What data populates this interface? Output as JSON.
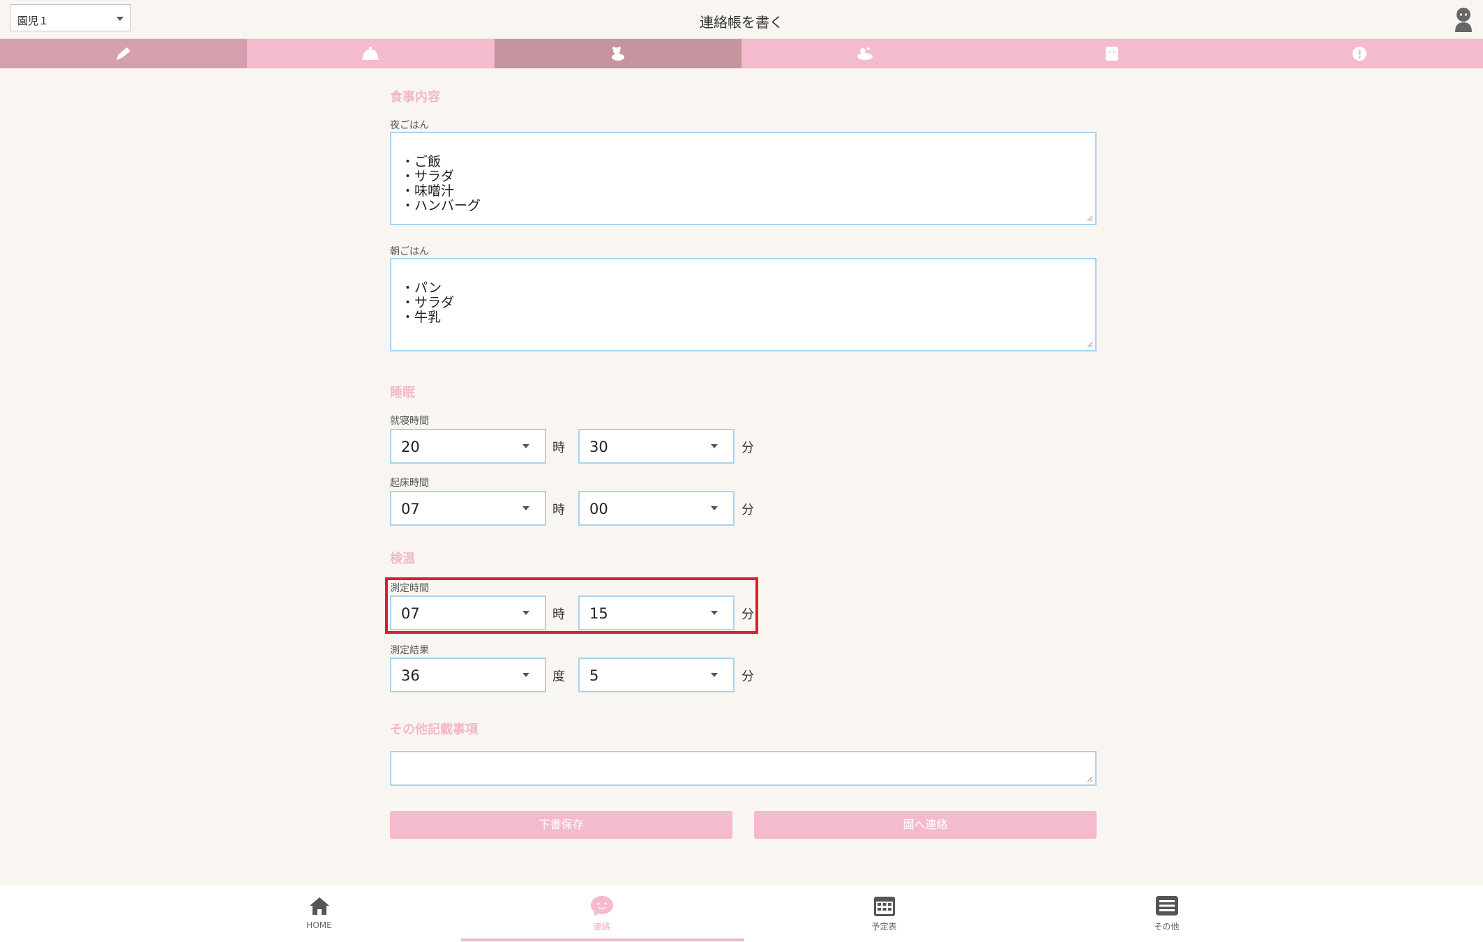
{
  "header": {
    "child_select": "園児１",
    "title": "連絡帳を書く"
  },
  "tabs": [
    {
      "icon": "pencil-icon"
    },
    {
      "icon": "meal-icon"
    },
    {
      "icon": "sleep-bear-icon"
    },
    {
      "icon": "bath-icon"
    },
    {
      "icon": "notebook-icon"
    },
    {
      "icon": "alert-icon"
    }
  ],
  "meal": {
    "section_title": "食事内容",
    "dinner_label": "夜ごはん",
    "dinner_value": "・ご飯\n・サラダ\n・味噌汁\n・ハンバーグ",
    "breakfast_label": "朝ごはん",
    "breakfast_value": "・パン\n・サラダ\n・牛乳"
  },
  "sleep": {
    "section_title": "睡眠",
    "bedtime_label": "就寝時間",
    "bedtime_hour": "20",
    "bedtime_minute": "30",
    "wake_label": "起床時間",
    "wake_hour": "07",
    "wake_minute": "00"
  },
  "temperature": {
    "section_title": "検温",
    "measure_time_label": "測定時間",
    "measure_hour": "07",
    "measure_minute": "15",
    "result_label": "測定結果",
    "result_degree": "36",
    "result_decimal": "5"
  },
  "units": {
    "hour": "時",
    "minute": "分",
    "degree": "度"
  },
  "notes": {
    "section_title": "その他記載事項",
    "value": ""
  },
  "buttons": {
    "save_draft": "下書保存",
    "send": "園へ連絡"
  },
  "bottom_nav": [
    {
      "label": "HOME",
      "icon": "home-icon"
    },
    {
      "label": "連絡",
      "icon": "chat-icon"
    },
    {
      "label": "予定表",
      "icon": "calendar-icon"
    },
    {
      "label": "その他",
      "icon": "menu-icon"
    }
  ],
  "colors": {
    "accent_pink": "#f4bacd",
    "tab_active": "#c4949f",
    "field_border": "#a9d3ee",
    "highlight": "#e01e2a"
  }
}
